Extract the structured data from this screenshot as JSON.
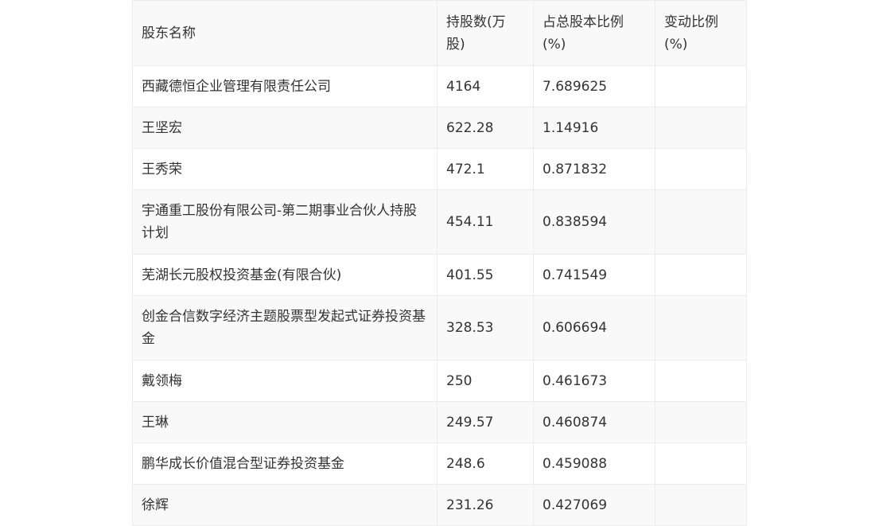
{
  "table": {
    "headers": [
      "股东名称",
      "持股数(万股)",
      "占总股本比例(%)",
      "变动比例(%)"
    ],
    "rows": [
      [
        "西藏德恒企业管理有限责任公司",
        "4164",
        "7.689625",
        ""
      ],
      [
        "王坚宏",
        "622.28",
        "1.14916",
        ""
      ],
      [
        "王秀荣",
        "472.1",
        "0.871832",
        ""
      ],
      [
        "宇通重工股份有限公司-第二期事业合伙人持股计划",
        "454.11",
        "0.838594",
        ""
      ],
      [
        "芜湖长元股权投资基金(有限合伙)",
        "401.55",
        "0.741549",
        ""
      ],
      [
        "创金合信数字经济主题股票型发起式证券投资基金",
        "328.53",
        "0.606694",
        ""
      ],
      [
        "戴领梅",
        "250",
        "0.461673",
        ""
      ],
      [
        "王琳",
        "249.57",
        "0.460874",
        ""
      ],
      [
        "鹏华成长价值混合型证券投资基金",
        "248.6",
        "0.459088",
        ""
      ],
      [
        "徐辉",
        "231.26",
        "0.427069",
        ""
      ]
    ]
  }
}
